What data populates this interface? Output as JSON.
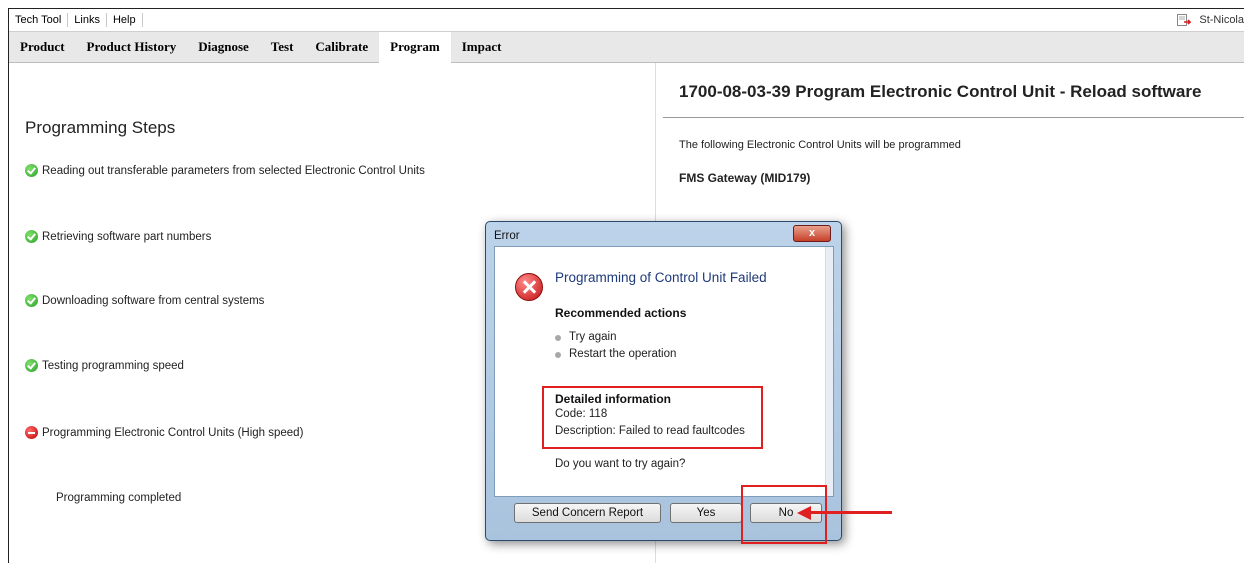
{
  "menubar": {
    "items": [
      "Tech Tool",
      "Links",
      "Help"
    ],
    "user": "St-Nicola"
  },
  "tabs": [
    {
      "label": "Product"
    },
    {
      "label": "Product History"
    },
    {
      "label": "Diagnose"
    },
    {
      "label": "Test"
    },
    {
      "label": "Calibrate"
    },
    {
      "label": "Program",
      "active": true
    },
    {
      "label": "Impact"
    }
  ],
  "steps": {
    "title": "Programming Steps",
    "items": [
      {
        "label": "Reading out transferable parameters from selected Electronic Control Units",
        "status": "ok"
      },
      {
        "label": "Retrieving software part numbers",
        "status": "ok"
      },
      {
        "label": "Downloading software from central systems",
        "status": "ok"
      },
      {
        "label": "Testing programming speed",
        "status": "ok"
      },
      {
        "label": "Programming Electronic Control Units (High speed)",
        "status": "fail"
      }
    ],
    "completed": "Programming completed"
  },
  "right": {
    "title": "1700-08-03-39 Program Electronic Control Unit - Reload software",
    "description": "The following Electronic Control Units will be programmed",
    "unit": "FMS Gateway (MID179)"
  },
  "dialog": {
    "title": "Error",
    "close": "x",
    "heading": "Programming of Control Unit Failed",
    "recommended_title": "Recommended actions",
    "recommended": [
      "Try again",
      "Restart the operation"
    ],
    "detail_title": "Detailed information",
    "code": "Code: 118",
    "description": "Description: Failed to read faultcodes",
    "question": "Do you want to try again?",
    "buttons": {
      "concern": "Send Concern Report",
      "yes": "Yes",
      "no": "No"
    }
  },
  "colors": {
    "highlight": "#e02020",
    "ok": "#2c9e2c",
    "fail": "#c00000",
    "dialog_heading": "#1f3a7a"
  }
}
